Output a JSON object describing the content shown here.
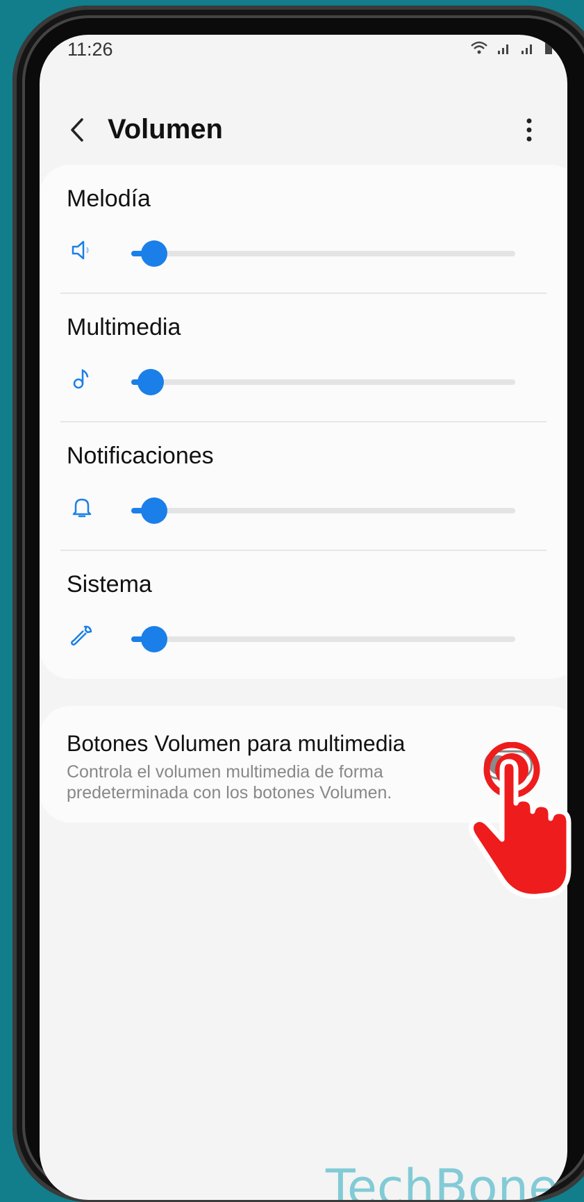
{
  "status_bar": {
    "time": "11:26",
    "icons": [
      "wifi-icon",
      "signal-icon",
      "signal-icon",
      "battery-icon"
    ]
  },
  "app_bar": {
    "title": "Volumen",
    "back_icon": "chevron-left-icon",
    "more_icon": "more-vertical-icon"
  },
  "volumes": [
    {
      "label": "Melodía",
      "icon": "speaker-icon",
      "level": 0.06
    },
    {
      "label": "Multimedia",
      "icon": "music-note-icon",
      "level": 0.05
    },
    {
      "label": "Notificaciones",
      "icon": "bell-icon",
      "level": 0.06
    },
    {
      "label": "Sistema",
      "icon": "wrench-icon",
      "level": 0.06
    }
  ],
  "media_toggle": {
    "title": "Botones Volumen para multimedia",
    "description": "Controla el volumen multimedia de forma predeterminada con los botones Volumen.",
    "enabled": false
  },
  "watermark": "TechBone",
  "colors": {
    "background": "#127d8b",
    "accent": "#1a7fe8",
    "tap_indicator": "#ee1c1c"
  }
}
